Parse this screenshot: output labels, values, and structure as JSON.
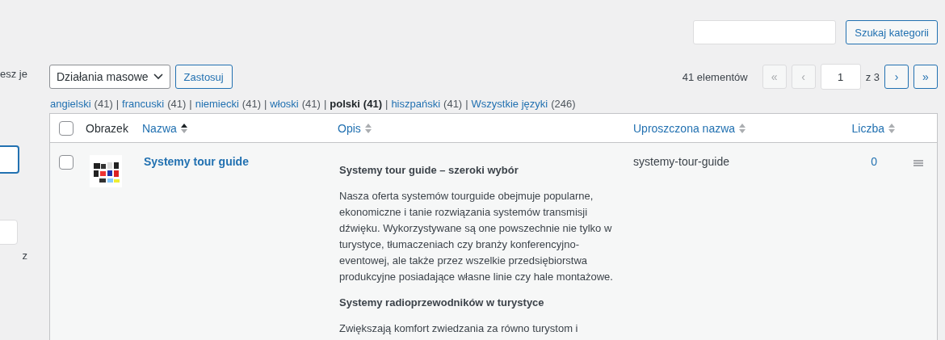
{
  "sidebar": {
    "texts": [
      "esz je",
      "z"
    ],
    "fields": [
      {
        "focused": true
      },
      {
        "focused": false
      }
    ]
  },
  "search": {
    "button": "Szukaj kategorii"
  },
  "bulk_actions": {
    "select": "Działania masowe",
    "apply": "Zastosuj"
  },
  "pagination": {
    "count": "41 elementów",
    "page": "1",
    "of": "z 3",
    "buttons": [
      {
        "label": "«",
        "disabled": true
      },
      {
        "label": "‹",
        "disabled": true
      },
      {
        "label": "›",
        "disabled": false
      },
      {
        "label": "»",
        "disabled": false
      }
    ]
  },
  "languages": [
    {
      "label": "angielski",
      "count": "(41)",
      "current": false,
      "separator": "|"
    },
    {
      "label": "francuski",
      "count": "(41)",
      "current": false,
      "separator": "|"
    },
    {
      "label": "niemiecki",
      "count": "(41)",
      "current": false,
      "separator": "|"
    },
    {
      "label": "włoski",
      "count": "(41)",
      "current": false,
      "separator": "|"
    },
    {
      "label": "polski",
      "count": "(41)",
      "current": true,
      "separator": "|"
    },
    {
      "label": "hiszpański",
      "count": "(41)",
      "current": false,
      "separator": "|"
    },
    {
      "label": "Wszystkie języki",
      "count": "(246)",
      "current": false
    }
  ],
  "table": {
    "select_all": {
      "checked": false
    },
    "columns": [
      {
        "label": "Obrazek",
        "sortable": false
      },
      {
        "label": "Nazwa",
        "sortable": true,
        "sorted": true
      },
      {
        "label": "Opis",
        "sortable": true,
        "sorted": false
      },
      {
        "label": "Uproszczona nazwa",
        "sortable": true,
        "sorted": false
      },
      {
        "label": "Liczba",
        "sortable": true,
        "sorted": false
      }
    ],
    "rows": [
      {
        "checked": false,
        "image": {
          "kind": "picture"
        },
        "name": "Systemy tour guide",
        "slug": "systemy-tour-guide",
        "count": "0",
        "description": [
          {
            "kind": "heading",
            "text": "Systemy tour guide – szeroki wybór"
          },
          {
            "kind": "paragraph",
            "text": "Nasza oferta systemów tourguide obejmuje popularne, ekonomiczne i tanie rozwiązania systemów transmisji dźwięku. Wykorzystywane są one powszechnie nie tylko w turystyce, tłumaczeniach czy branży konferencyjno-eventowej, ale także przez wszelkie przedsiębiorstwa produkcyjne posiadające własne linie czy hale montażowe."
          },
          {
            "kind": "heading",
            "text": "Systemy radioprzewodników w turystyce"
          },
          {
            "kind": "paragraph",
            "text": "Zwiększają komfort zwiedzania za równo turystom i"
          }
        ]
      }
    ]
  }
}
